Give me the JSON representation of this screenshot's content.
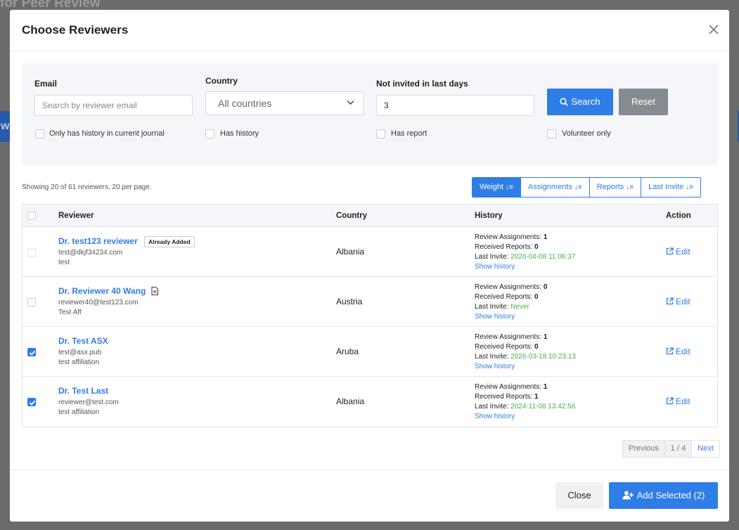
{
  "backdrop": {
    "title": "for Peer Review",
    "bar_letter": "w"
  },
  "modal": {
    "title": "Choose Reviewers"
  },
  "filters": {
    "email_label": "Email",
    "email_placeholder": "Search by reviewer email",
    "country_label": "Country",
    "country_value": "All countries",
    "days_label": "Not invited in last days",
    "days_value": "3",
    "search_label": "Search",
    "reset_label": "Reset",
    "checkboxes": [
      "Only has history in current journal",
      "Has history",
      "Has report",
      "Volunteer only"
    ]
  },
  "summary": "Showing 20 of 61 reviewers, 20 per page.",
  "sort": {
    "buttons": [
      "Weight",
      "Assignments",
      "Reports",
      "Last Invite"
    ],
    "active": "Weight"
  },
  "table": {
    "headers": {
      "reviewer": "Reviewer",
      "country": "Country",
      "history": "History",
      "action": "Action"
    },
    "labels": {
      "assignments": "Review Assignments:",
      "reports": "Received Reports:",
      "last_invite": "Last Invite:",
      "show_history": "Show history",
      "edit": "Edit",
      "already_added": "Already Added"
    },
    "rows": [
      {
        "name": "Dr. test123 reviewer",
        "email": "test@dkjf34234.com",
        "affiliation": "test",
        "country": "Albania",
        "assignments": "1",
        "reports": "0",
        "last_invite": "2026-04-08 11:06:37",
        "checked": false,
        "already_added": true
      },
      {
        "name": "Dr. Reviewer 40 Wang",
        "email": "reviewer40@test123.com",
        "affiliation": "Test Aff",
        "country": "Austria",
        "assignments": "0",
        "reports": "0",
        "last_invite": "Never",
        "checked": false,
        "has_report_icon": true
      },
      {
        "name": "Dr. Test ASX",
        "email": "test@asx.pub",
        "affiliation": "test affiliation",
        "country": "Aruba",
        "assignments": "1",
        "reports": "0",
        "last_invite": "2026-03-18 10:23:13",
        "checked": true
      },
      {
        "name": "Dr. Test Last",
        "email": "reviewer@test.com",
        "affiliation": "test affiliation",
        "country": "Albania",
        "assignments": "1",
        "reports": "1",
        "last_invite": "2024-11-08 13:42:56",
        "checked": true
      }
    ]
  },
  "pagination": {
    "previous": "Previous",
    "info": "1 / 4",
    "next": "Next"
  },
  "footer": {
    "close_label": "Close",
    "add_label": "Add Selected (2)"
  },
  "colors": {
    "accent": "#2f7de7",
    "invite_green": "#4caf50",
    "reset_gray": "#868b92"
  }
}
